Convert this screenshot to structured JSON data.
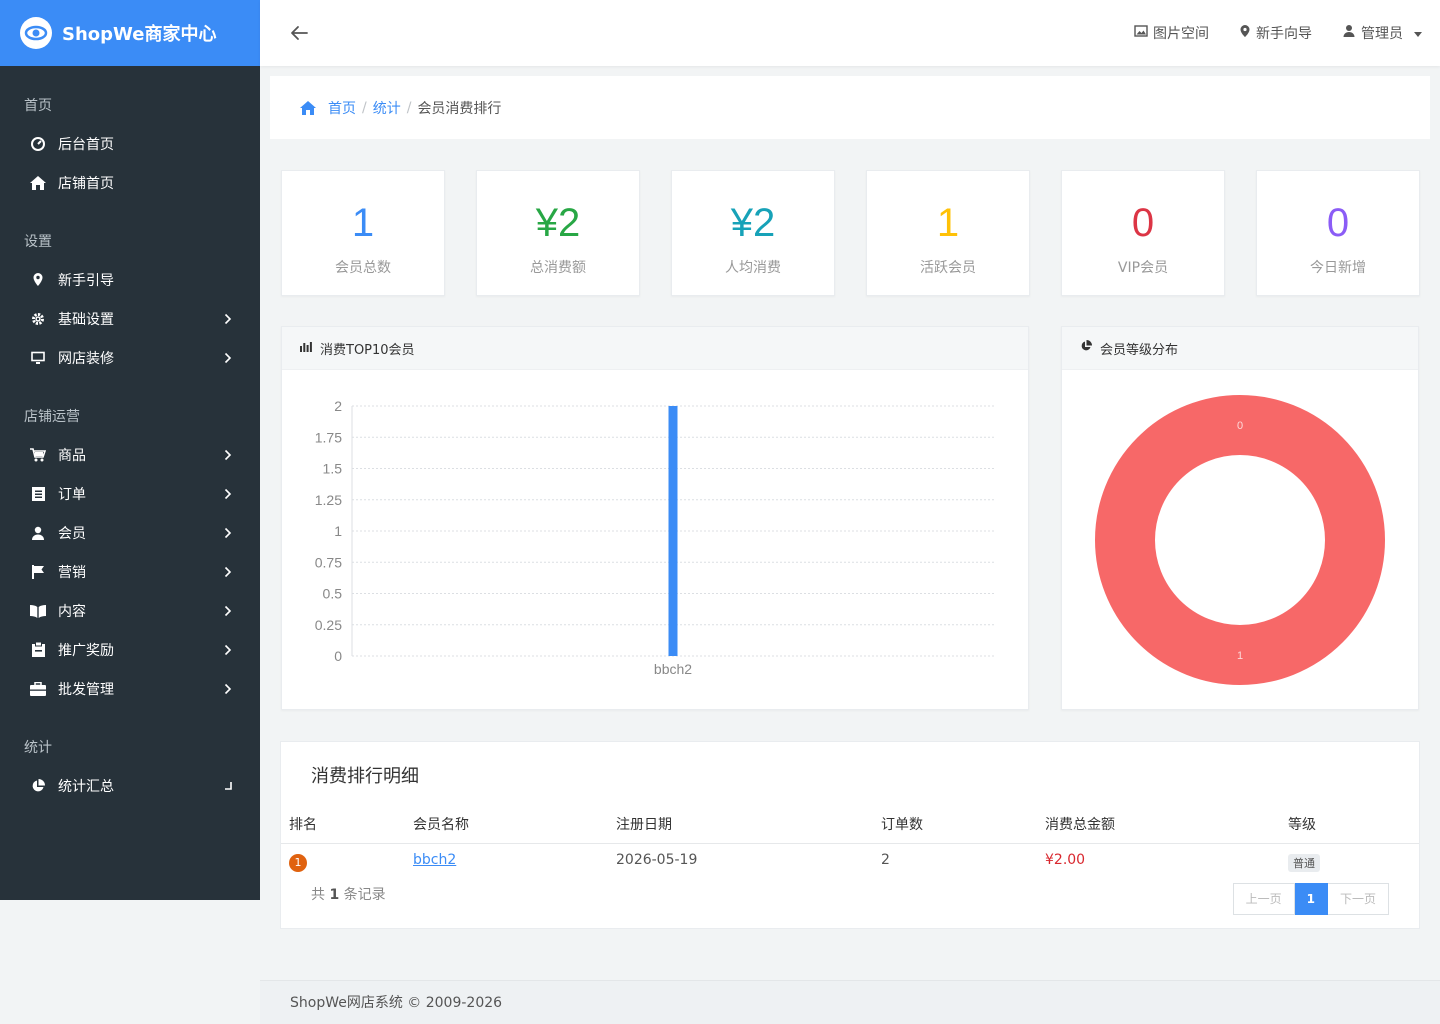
{
  "brand": {
    "name": "ShopWe商家中心"
  },
  "sidebar": {
    "sections": [
      {
        "title": "首页",
        "items": [
          {
            "label": "后台首页",
            "icon": "dashboard-icon",
            "has_children": false
          },
          {
            "label": "店铺首页",
            "icon": "home-icon",
            "has_children": false
          }
        ]
      },
      {
        "title": "设置",
        "items": [
          {
            "label": "新手引导",
            "icon": "map-pin-icon",
            "has_children": false
          },
          {
            "label": "基础设置",
            "icon": "gear-icon",
            "has_children": true
          },
          {
            "label": "网店装修",
            "icon": "monitor-icon",
            "has_children": true
          }
        ]
      },
      {
        "title": "店铺运营",
        "items": [
          {
            "label": "商品",
            "icon": "cart-icon",
            "has_children": true
          },
          {
            "label": "订单",
            "icon": "list-icon",
            "has_children": true
          },
          {
            "label": "会员",
            "icon": "user-icon",
            "has_children": true
          },
          {
            "label": "营销",
            "icon": "flag-icon",
            "has_children": true
          },
          {
            "label": "内容",
            "icon": "book-icon",
            "has_children": true
          },
          {
            "label": "推广奖励",
            "icon": "clipboard-icon",
            "has_children": true
          },
          {
            "label": "批发管理",
            "icon": "briefcase-icon",
            "has_children": true
          }
        ]
      },
      {
        "title": "统计",
        "items": [
          {
            "label": "统计汇总",
            "icon": "pie-chart-icon",
            "has_children": true,
            "expanded": true
          }
        ]
      }
    ]
  },
  "topbar": {
    "actions": [
      {
        "label": "图片空间",
        "icon": "image-icon"
      },
      {
        "label": "新手向导",
        "icon": "map-pin-icon"
      },
      {
        "label": "管理员",
        "icon": "user-icon"
      }
    ]
  },
  "breadcrumb": {
    "home": "首页",
    "parent": "统计",
    "current": "会员消费排行",
    "separator": "/"
  },
  "stats": [
    {
      "value": "1",
      "label": "会员总数",
      "color": "#3b8cf6"
    },
    {
      "value": "¥2",
      "label": "总消费额",
      "color": "#28a745"
    },
    {
      "value": "¥2",
      "label": "人均消费",
      "color": "#17a2b8"
    },
    {
      "value": "1",
      "label": "活跃会员",
      "color": "#ffc107"
    },
    {
      "value": "0",
      "label": "VIP会员",
      "color": "#dc3545"
    },
    {
      "value": "0",
      "label": "今日新增",
      "color": "#8b5cf6"
    }
  ],
  "bar_panel": {
    "title": "消费TOP10会员"
  },
  "pie_panel": {
    "title": "会员等级分布"
  },
  "chart_data": [
    {
      "type": "bar",
      "categories": [
        "bbch2"
      ],
      "values": [
        2
      ],
      "ylim": [
        0,
        2
      ],
      "yticks": [
        "0",
        "0.25",
        "0.5",
        "0.75",
        "1",
        "1.25",
        "1.5",
        "1.75",
        "2"
      ],
      "grid": true,
      "bar_color": "#3b8cf6"
    },
    {
      "type": "pie",
      "donut": true,
      "values": [
        0,
        1
      ],
      "value_labels": [
        "0",
        "1"
      ],
      "color": "#f76868"
    }
  ],
  "table": {
    "title": "消费排行明细",
    "columns": [
      "排名",
      "会员名称",
      "注册日期",
      "订单数",
      "消费总金额",
      "等级"
    ],
    "rows": [
      {
        "rank": "1",
        "name": "bbch2",
        "reg_date": "2026-05-19",
        "orders": "2",
        "amount": "¥2.00",
        "level": "普通"
      }
    ],
    "total_prefix": "共",
    "total_count": "1",
    "total_suffix": "条记录",
    "pager": {
      "prev": "上一页",
      "current": "1",
      "next": "下一页"
    }
  },
  "footer": {
    "text": "ShopWe网店系统 © 2009-2026"
  }
}
